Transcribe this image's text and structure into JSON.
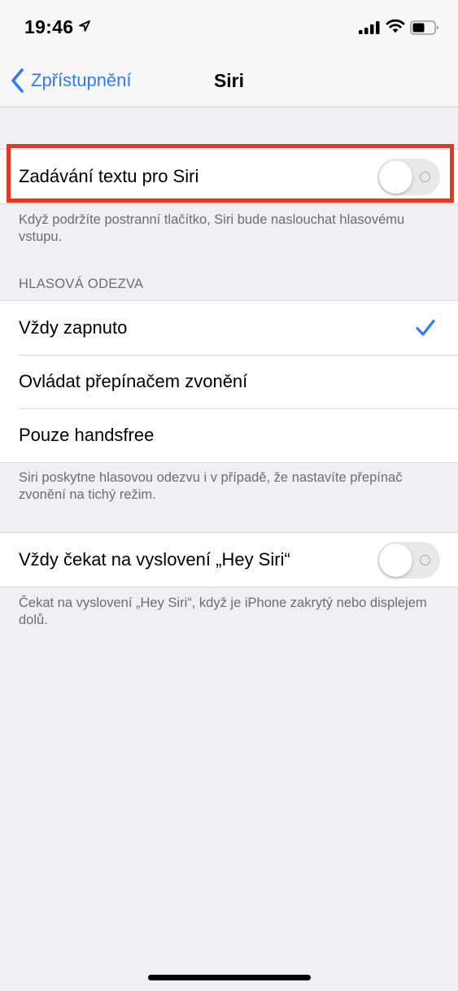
{
  "status_bar": {
    "time": "19:46",
    "icons": [
      "location-arrow-icon",
      "cellular-signal-icon",
      "wifi-icon",
      "battery-icon"
    ]
  },
  "nav": {
    "back_label": "Zpřístupnění",
    "title": "Siri"
  },
  "type_to_siri": {
    "label": "Zadávání textu pro Siri",
    "toggle_state": "off",
    "footer": "Když podržíte postranní tlačítko, Siri bude naslouchat hlasovému vstupu."
  },
  "voice_feedback": {
    "header": "HLASOVÁ ODEZVA",
    "options": [
      {
        "label": "Vždy zapnuto",
        "selected": true
      },
      {
        "label": "Ovládat přepínačem zvonění",
        "selected": false
      },
      {
        "label": "Pouze handsfree",
        "selected": false
      }
    ],
    "footer": "Siri poskytne hlasovou odezvu i v případě, že nastavíte přepínač zvonění na tichý režim."
  },
  "hey_siri": {
    "label": "Vždy čekat na vyslovení „Hey Siri“",
    "toggle_state": "off",
    "footer": "Čekat na vyslovení „Hey Siri“, když je iPhone zakrytý nebo displejem dolů."
  },
  "colors": {
    "accent": "#2f7cf6",
    "highlight": "#e2391f",
    "background": "#efeff4",
    "secondary_text": "#6d6d72"
  }
}
